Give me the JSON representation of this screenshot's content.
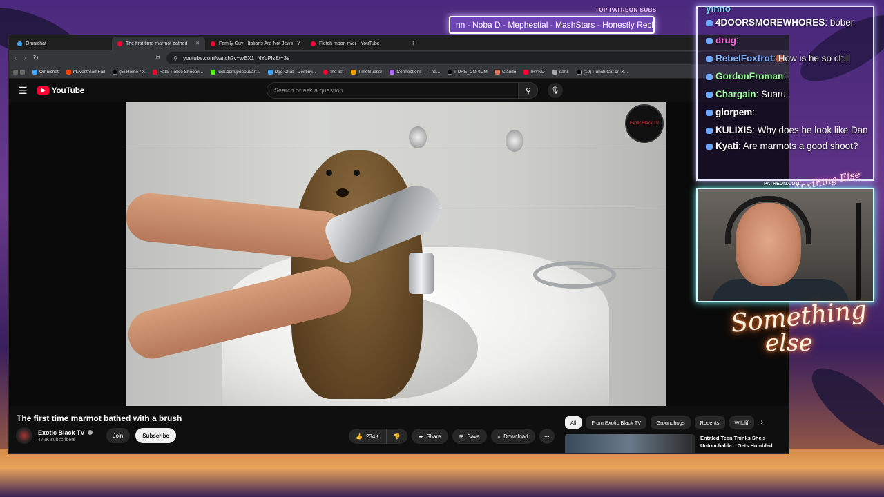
{
  "overlay": {
    "patreon_label": "TOP PATREON SUBS",
    "patreon_ticker": "nn -  Noba D - Mephestial - MashStars - Honestly Reckles",
    "patreon_url": "PATREON.COM/",
    "logo_signature": "Anything Else",
    "neon_line1": "Something",
    "neon_line2": "else"
  },
  "browser": {
    "tabs": [
      {
        "label": "Omnichat",
        "active": false
      },
      {
        "label": "The first time marmot bathed",
        "active": true
      },
      {
        "label": "Family Guy - Italians Are Not Jews - Y",
        "active": false
      },
      {
        "label": "Fletch moon river - YouTube",
        "active": false
      }
    ],
    "url": "youtube.com/watch?v=wEX1_NYoPls&t=3s",
    "bookmarks": [
      "Omnichat",
      "r/LivestreamFail",
      "(5) Home / X",
      "Fatal Police Shootin...",
      "kick.com/popout/an...",
      "Dgg Chat - Destiny...",
      "the list",
      "TimeGuessr",
      "Connections — The...",
      "PURE_COPIUM",
      "Claude",
      "IHYND",
      "dans",
      "(19) Punch Cat on X..."
    ]
  },
  "youtube": {
    "logo_text": "YouTube",
    "search_placeholder": "Search or ask a question",
    "video_title": "The first time marmot bathed with a brush",
    "channel_name": "Exotic Black TV",
    "subscribers": "472K subscribers",
    "join_label": "Join",
    "subscribe_label": "Subscribe",
    "likes": "234K",
    "share_label": "Share",
    "save_label": "Save",
    "download_label": "Download",
    "chips": [
      "All",
      "From Exotic Black TV",
      "Groundhogs",
      "Rodents",
      "Wildlif"
    ],
    "recommendation_title": "Entitled Teen Thinks She's Untouchable... Gets Humbled",
    "watermark_text": "Exotic Black TV"
  },
  "chat": {
    "messages": [
      {
        "user": "yinno",
        "text": "",
        "color": "#7fd8ff"
      },
      {
        "user": "4DOORSMOREWHORES",
        "text": ": bober",
        "color": "#ffffff"
      },
      {
        "user": "drug",
        "text": ":",
        "color": "#ff5fe0"
      },
      {
        "user": "RebelFoxtrot",
        "text": ": How is he so chill",
        "color": "#7fb2ff"
      },
      {
        "user": "GordonFroman",
        "text": ":",
        "color": "#9dff9d"
      },
      {
        "user": "Chargain",
        "text": ": Suaru",
        "color": "#9dff9d"
      },
      {
        "user": "glorpem",
        "text": ":",
        "color": "#ffffff"
      },
      {
        "user": "KULIXIS",
        "text": ": Why does he look like Dan",
        "color": "#ffffff"
      },
      {
        "user": "Kyati",
        "text": ": Are marmots a good shoot?",
        "color": "#ffffff"
      }
    ]
  }
}
